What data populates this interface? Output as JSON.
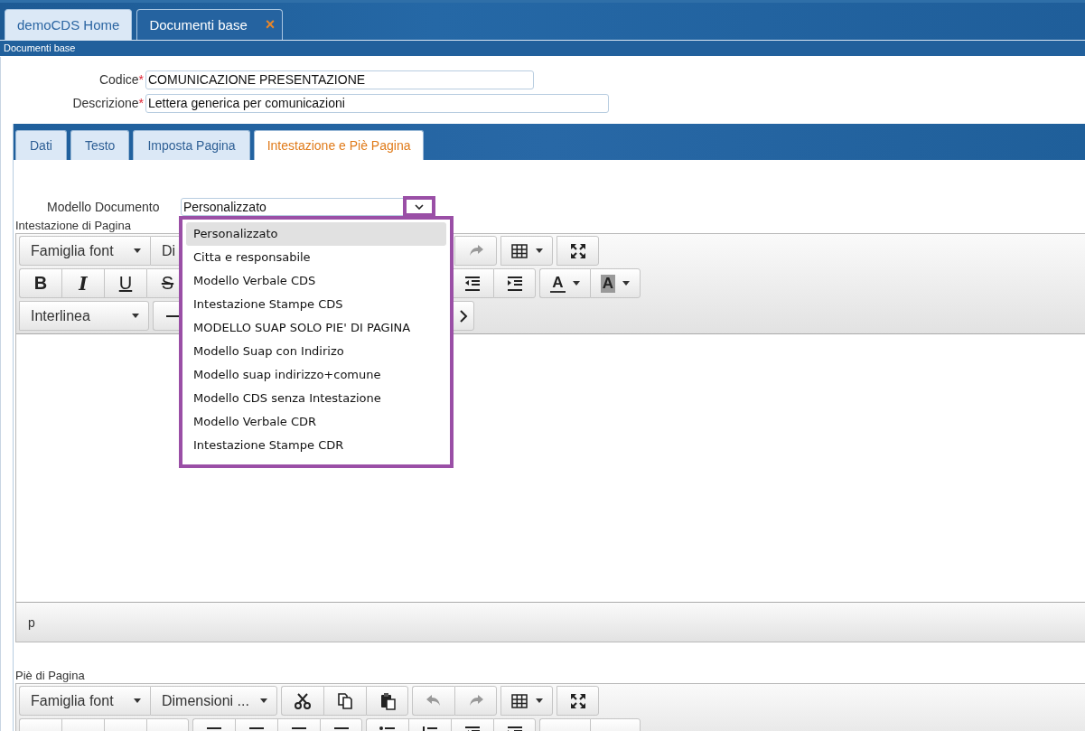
{
  "app_tabs": [
    {
      "label": "demoCDS Home",
      "selected": false
    },
    {
      "label": "Documenti base",
      "selected": true,
      "close": "×"
    }
  ],
  "breadcrumb": "Documenti base",
  "fields": [
    {
      "label": "Codice",
      "required_mark": "*",
      "value": "COMUNICAZIONE PRESENTAZIONE"
    },
    {
      "label": "Descrizione",
      "required_mark": "*",
      "value": "Lettera generica per comunicazioni"
    }
  ],
  "tabs": [
    {
      "label": "Dati",
      "selected": false
    },
    {
      "label": "Testo",
      "selected": false
    },
    {
      "label": "Imposta Pagina",
      "selected": false
    },
    {
      "label": "Intestazione e Piè Pagina",
      "selected": true
    }
  ],
  "model_select": {
    "label": "Modello Documento",
    "value": "Personalizzato",
    "expanded": true,
    "options": [
      {
        "label": "Personalizzato",
        "selected": true
      },
      {
        "label": "Citta e responsabile",
        "selected": false
      },
      {
        "label": "Modello Verbale CDS",
        "selected": false
      },
      {
        "label": "Intestazione Stampe CDS",
        "selected": false
      },
      {
        "label": "MODELLO SUAP SOLO PIE' DI PAGINA",
        "selected": false
      },
      {
        "label": "Modello Suap con Indirizo",
        "selected": false
      },
      {
        "label": "Modello suap indirizzo+comune",
        "selected": false
      },
      {
        "label": "Modello CDS senza Intestazione",
        "selected": false
      },
      {
        "label": "Modello Verbale CDR",
        "selected": false
      },
      {
        "label": "Intestazione Stampe CDR",
        "selected": false
      }
    ]
  },
  "editors": [
    {
      "label": "Intestazione di Pagina",
      "toolbar": {
        "font_family": "Famiglia font",
        "font_size": "Di",
        "bold": "B",
        "italic": "I",
        "underline": "U",
        "strike": "S",
        "text_color": "A",
        "bg_color": "A",
        "line_height": "Interlinea"
      },
      "status": "p"
    },
    {
      "label": "Piè di Pagina",
      "toolbar": {
        "font_family": "Famiglia font",
        "font_size": "Dimensioni ..."
      }
    }
  ]
}
